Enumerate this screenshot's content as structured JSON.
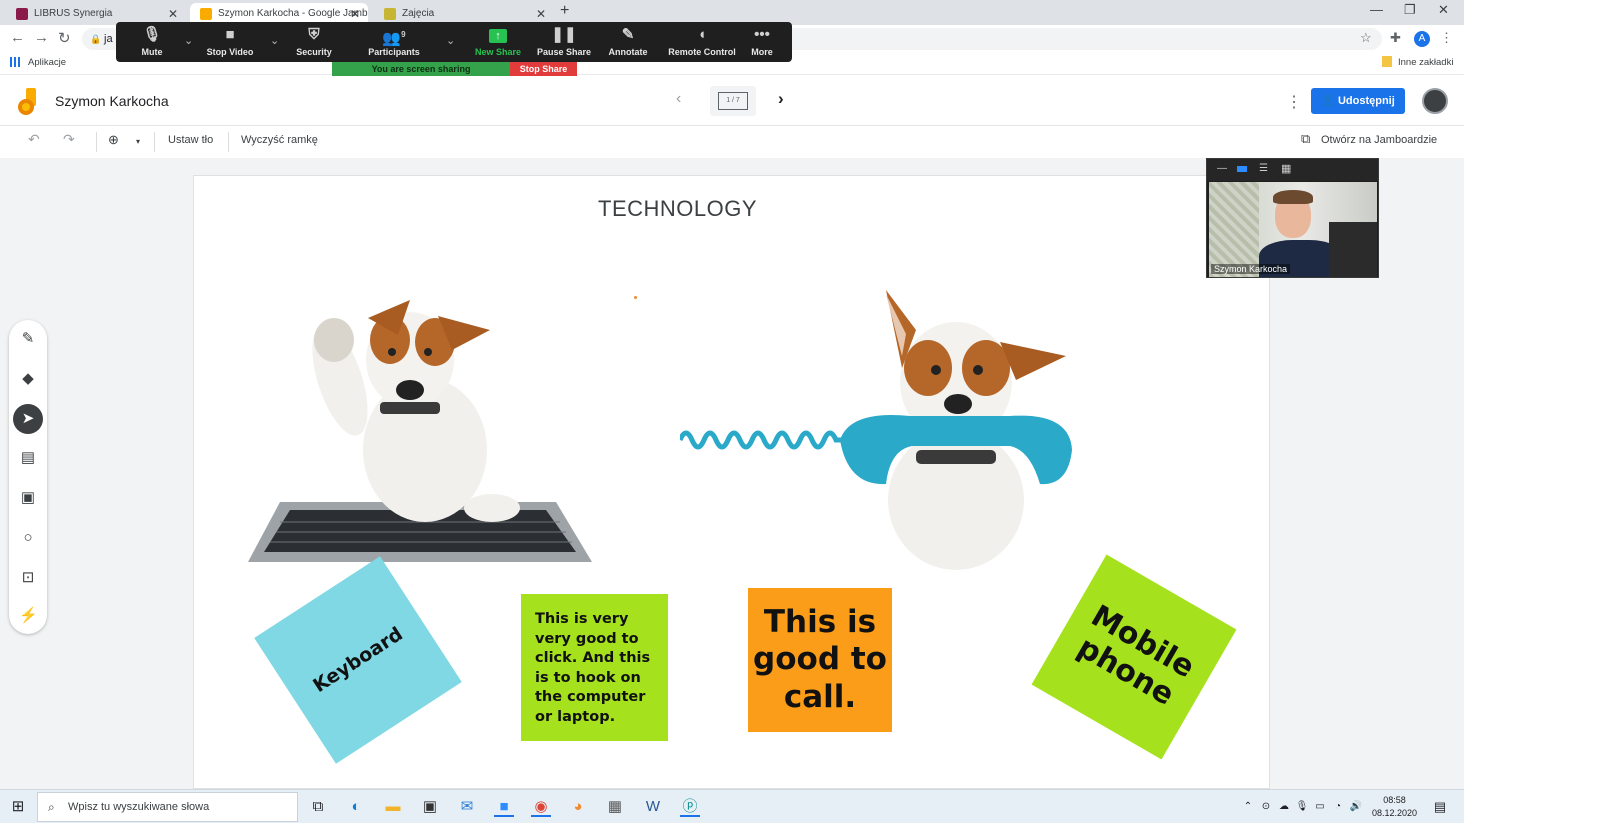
{
  "browser": {
    "tabs": [
      {
        "title": "LIBRUS Synergia",
        "active": false
      },
      {
        "title": "Szymon Karkocha - Google Jamb",
        "active": true
      },
      {
        "title": "Zajęcia",
        "active": false
      }
    ],
    "url": "ja",
    "bookmarks": {
      "apps_label": "Aplikacje",
      "other_label": "Inne zakładki"
    },
    "profile_initial": "A"
  },
  "zoom": {
    "toolbar": [
      {
        "label": "Mute",
        "icon": "microphone-icon"
      },
      {
        "label": "Stop Video",
        "icon": "video-camera-icon"
      },
      {
        "label": "Security",
        "icon": "shield-icon"
      },
      {
        "label": "Participants",
        "icon": "participants-icon",
        "count": "9"
      },
      {
        "label": "New Share",
        "icon": "share-screen-icon"
      },
      {
        "label": "Pause Share",
        "icon": "pause-icon"
      },
      {
        "label": "Annotate",
        "icon": "pencil-icon"
      },
      {
        "label": "Remote Control",
        "icon": "mouse-icon"
      },
      {
        "label": "More",
        "icon": "more-icon"
      }
    ],
    "sharing_text": "You are screen sharing",
    "stop_share": "Stop Share",
    "participant_name": "Szymon Karkocha"
  },
  "jamboard": {
    "title": "Szymon Karkocha",
    "frame_indicator": "1 / 7",
    "share_label": "Udostępnij",
    "toolbar": {
      "set_background": "Ustaw tło",
      "clear_frame": "Wyczyść ramkę",
      "open_in_jamboard": "Otwórz na Jamboardzie"
    },
    "board_title": "TECHNOLOGY",
    "tools": [
      "pen-icon",
      "eraser-icon",
      "select-icon",
      "sticky-note-icon",
      "image-icon",
      "circle-icon",
      "text-box-icon",
      "laser-icon"
    ],
    "notes": {
      "keyboard": "Keyboard",
      "green_note": "This is very very good to click. And this is to hook on the computer or laptop.",
      "orange_note": "This is good to call.",
      "mobile": "Mobile phone"
    }
  },
  "taskbar": {
    "search_placeholder": "Wpisz tu wyszukiwane słowa",
    "time": "08:58",
    "date": "08.12.2020"
  },
  "colors": {
    "zoom_bar": "#1f1f1f",
    "share_green": "#34a24a",
    "stop_red": "#e23b3b",
    "jam_blue": "#1a73e8",
    "note_blue": "#7fd8e4",
    "note_green": "#a6e11d",
    "note_orange": "#fb9d18"
  }
}
